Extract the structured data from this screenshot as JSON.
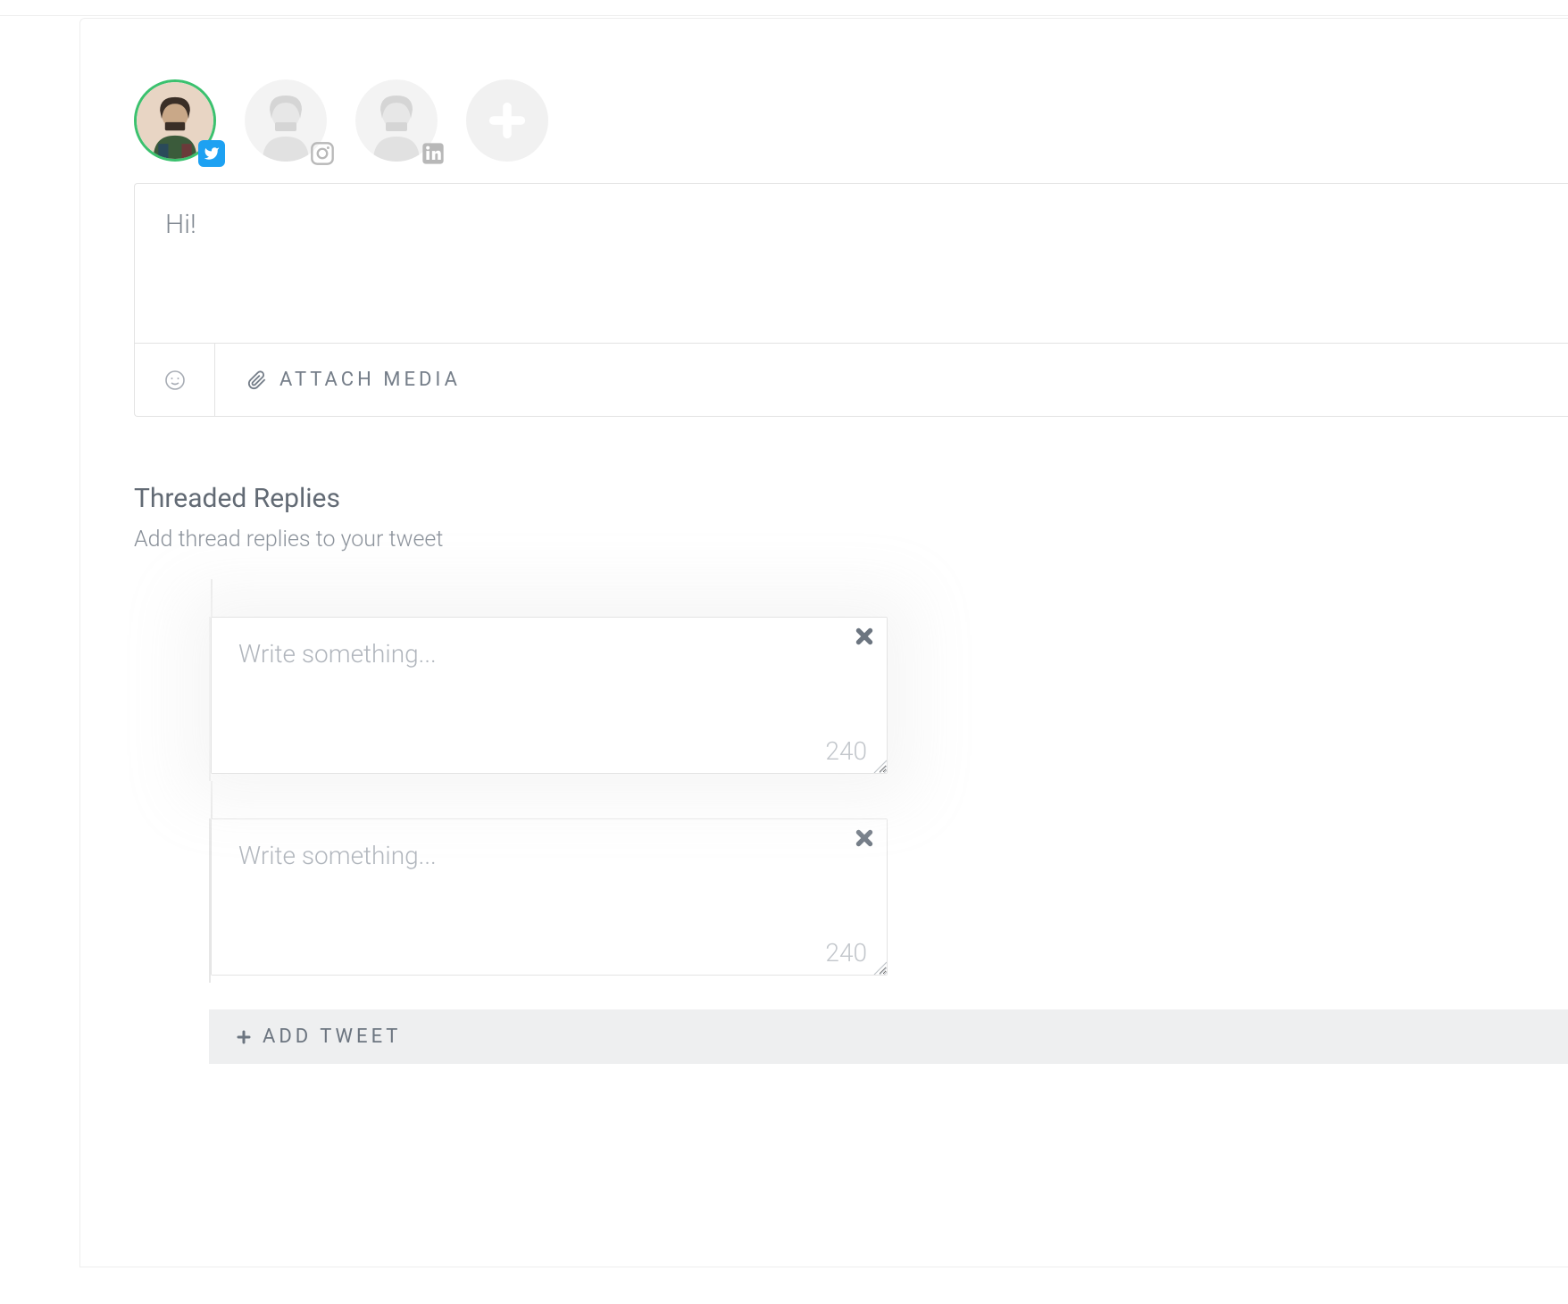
{
  "accounts": [
    {
      "platform": "twitter",
      "selected": true
    },
    {
      "platform": "instagram",
      "selected": false
    },
    {
      "platform": "linkedin",
      "selected": false
    }
  ],
  "compose": {
    "text": "Hi!",
    "attach_label": "ATTACH MEDIA"
  },
  "threaded": {
    "title": "Threaded Replies",
    "subtitle": "Add thread replies to your tweet",
    "replies": [
      {
        "placeholder": "Write something...",
        "counter": "240"
      },
      {
        "placeholder": "Write something...",
        "counter": "240"
      }
    ],
    "add_tweet_label": "ADD TWEET"
  }
}
